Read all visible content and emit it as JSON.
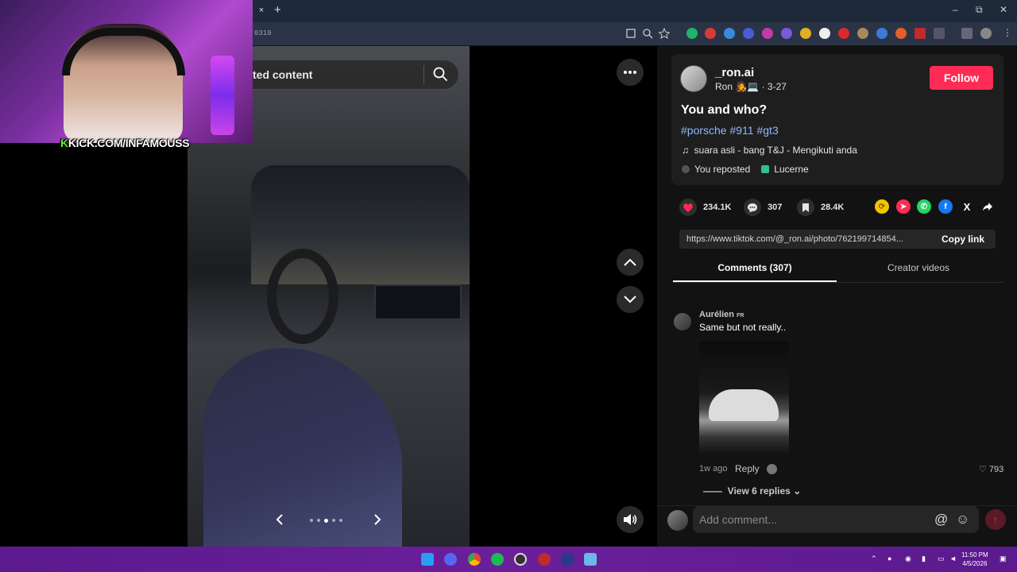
{
  "browser": {
    "url_fragment": "0310",
    "tab_close": "×",
    "new_tab": "+",
    "minimize": "–",
    "maximize": "⧉",
    "close": "✕"
  },
  "webcam": {
    "label_k": "K",
    "label_text": "KICK.COM/INFAMOUSS"
  },
  "search": {
    "text": "ted content"
  },
  "photo": {
    "carousel_total": 5,
    "carousel_active": 3
  },
  "post": {
    "username": "_ron.ai",
    "display_name": "Ron",
    "emojis": "🧑‍🎤💻",
    "date": "3-27",
    "follow_label": "Follow",
    "title": "You and who?",
    "hashtags": "#porsche #911 #gt3",
    "music_icon": "♫",
    "music": "suara asli - bang T&J - Mengikuti anda",
    "reposted": "You reposted",
    "location": "Lucerne"
  },
  "stats": {
    "likes": "234.1K",
    "comments": "307",
    "saves": "28.4K"
  },
  "share": {
    "link": "https://www.tiktok.com/@_ron.ai/photo/762199714854...",
    "copy_label": "Copy link",
    "x_label": "X"
  },
  "tabs": {
    "comments": "Comments (307)",
    "creator": "Creator videos"
  },
  "comment": {
    "user": "Aurélien",
    "flag": "FR",
    "text": "Same but not really..",
    "time": "1w ago",
    "reply": "Reply",
    "likes": "793",
    "view_replies": "View 6 replies"
  },
  "comment_bar": {
    "placeholder": "Add comment...",
    "at": "@",
    "emoji": "☺",
    "send": "↑"
  },
  "taskbar": {
    "time": "11:50 PM",
    "date": "4/5/2026"
  },
  "colors": {
    "accent": "#fe2c55",
    "hashtag": "#8fb8ff",
    "taskbar": "#5b1a8e"
  }
}
